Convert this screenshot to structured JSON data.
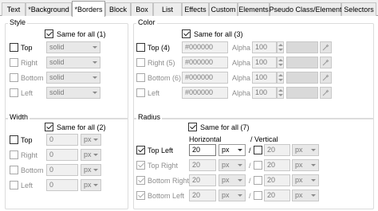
{
  "tabs": [
    "Text",
    "*Background",
    "*Borders",
    "Block",
    "Box",
    "List",
    "Effects",
    "Custom",
    "Elements",
    "Pseudo Class/Element",
    "Selectors"
  ],
  "active_tab": "*Borders",
  "style_group": {
    "title": "Style",
    "same_for_all": "Same for all (1)",
    "rows": [
      {
        "label": "Top",
        "value": "solid"
      },
      {
        "label": "Right",
        "value": "solid"
      },
      {
        "label": "Bottom",
        "value": "solid"
      },
      {
        "label": "Left",
        "value": "solid"
      }
    ]
  },
  "color_group": {
    "title": "Color",
    "same_for_all": "Same for all (3)",
    "alpha_label": "Alpha",
    "rows": [
      {
        "label": "Top (4)",
        "color": "#000000",
        "alpha": "100"
      },
      {
        "label": "Right (5)",
        "color": "#000000",
        "alpha": "100"
      },
      {
        "label": "Bottom (6)",
        "color": "#000000",
        "alpha": "100"
      },
      {
        "label": "Left",
        "color": "#000000",
        "alpha": "100"
      }
    ]
  },
  "width_group": {
    "title": "Width",
    "same_for_all": "Same for all (2)",
    "rows": [
      {
        "label": "Top",
        "value": "0",
        "unit": "px"
      },
      {
        "label": "Right",
        "value": "0",
        "unit": "px"
      },
      {
        "label": "Bottom",
        "value": "0",
        "unit": "px"
      },
      {
        "label": "Left",
        "value": "0",
        "unit": "px"
      }
    ]
  },
  "radius_group": {
    "title": "Radius",
    "same_for_all": "Same for all (7)",
    "horizontal_label": "Horizontal",
    "vertical_label": "/ Vertical",
    "separator": "/",
    "rows": [
      {
        "label": "Top Left",
        "h_value": "20",
        "h_unit": "px",
        "v_value": "20",
        "v_unit": "px"
      },
      {
        "label": "Top Right",
        "h_value": "20",
        "h_unit": "px",
        "v_value": "20",
        "v_unit": "px"
      },
      {
        "label": "Bottom Right",
        "h_value": "20",
        "h_unit": "px",
        "v_value": "20",
        "v_unit": "px"
      },
      {
        "label": "Bottom Left",
        "h_value": "20",
        "h_unit": "px",
        "v_value": "20",
        "v_unit": "px"
      }
    ]
  }
}
